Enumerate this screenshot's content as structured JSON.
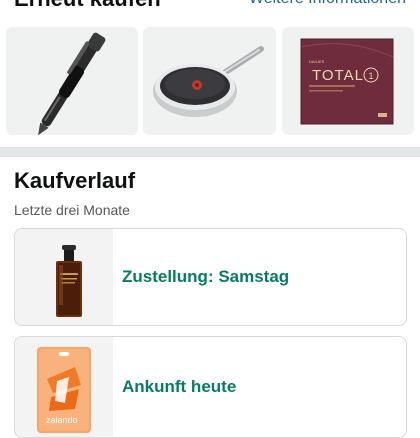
{
  "buy_again": {
    "title": "Erneut kaufen",
    "more_link": "Weitere Informationen",
    "products": [
      {
        "icon": "pen-icon"
      },
      {
        "icon": "frying-pan-icon"
      },
      {
        "icon": "contact-lens-box-icon",
        "box_text": "TOTAL",
        "box_number": "1"
      }
    ]
  },
  "purchase_history": {
    "title": "Kaufverlauf",
    "subtitle": "Letzte drei Monate",
    "orders": [
      {
        "status": "Zustellung: Samstag",
        "icon": "serum-bottle-icon"
      },
      {
        "status": "Ankunft heute",
        "icon": "zalando-gift-card-icon",
        "card_text": "zalando"
      }
    ]
  },
  "colors": {
    "status_green": "#067d62",
    "link_blue": "#2162a1",
    "divider": "#e3e6e6"
  }
}
